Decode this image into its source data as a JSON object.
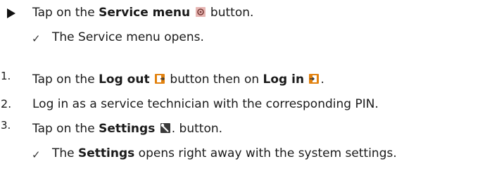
{
  "steps": [
    {
      "marker": "",
      "pre": "Tap on the ",
      "bold1": "Service menu",
      "mid": "",
      "bold2": "",
      "post": " button."
    },
    {
      "marker": "✓",
      "pre": "The Service menu opens.",
      "bold1": "",
      "mid": "",
      "bold2": "",
      "post": ""
    },
    {
      "marker": "1.",
      "pre": "Tap on the ",
      "bold1": "Log out",
      "mid": " button then on ",
      "bold2": "Log in",
      "post": "."
    },
    {
      "marker": "2.",
      "pre": "Log in as a service technician with the corresponding PIN.",
      "bold1": "",
      "mid": "",
      "bold2": "",
      "post": ""
    },
    {
      "marker": "3.",
      "pre": "Tap on the ",
      "bold1": "Settings",
      "mid": "",
      "bold2": "",
      "post": ". button."
    },
    {
      "marker": "✓",
      "pre": "The ",
      "bold1": "Settings",
      "mid": " opens right away with the system settings.",
      "bold2": "",
      "post": ""
    }
  ],
  "icons": {
    "service": "gear-icon",
    "logout": "logout-icon",
    "login": "login-icon",
    "settings": "wrench-icon"
  },
  "colors": {
    "icon_orange": "#e2820f",
    "icon_dark": "#3a3a3a",
    "gear_pink": "#e7b6b3"
  }
}
